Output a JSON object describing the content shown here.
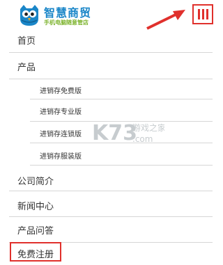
{
  "brand": {
    "title": "智慧商贸",
    "subtitle": "手机电脑随意管店",
    "accent_blue": "#1a86c8",
    "accent_green": "#7cb32c"
  },
  "menu_button": {
    "icon": "menu-icon",
    "color": "#e0302c"
  },
  "nav": {
    "items": [
      {
        "label": "首页"
      },
      {
        "label": "产品"
      },
      {
        "label": "公司简介"
      },
      {
        "label": "新闻中心"
      },
      {
        "label": "产品问答"
      },
      {
        "label": "免费注册"
      }
    ],
    "sub_items": [
      {
        "label": "进销存免费版"
      },
      {
        "label": "进销存专业版"
      },
      {
        "label": "进销存连锁版"
      },
      {
        "label": "进销存服装版"
      }
    ]
  },
  "watermark": {
    "logo": "K73",
    "text": "游戏之家",
    "domain": ".com"
  }
}
